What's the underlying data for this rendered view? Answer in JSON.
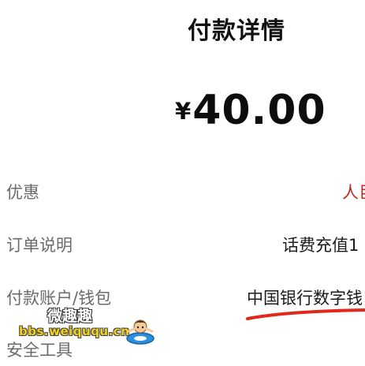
{
  "header": {
    "title": "付款详情"
  },
  "payment": {
    "currency_symbol": "¥",
    "amount": "40.00"
  },
  "details": {
    "discount": {
      "label": "优惠",
      "value": "人巨"
    },
    "order": {
      "label": "订单说明",
      "value": "话费充值1"
    },
    "account": {
      "label": "付款账户/钱包",
      "value": "中国银行数字钱"
    },
    "tool": {
      "label": "安全工具"
    }
  },
  "annotation": {
    "underline_color": "#e0281d"
  },
  "watermark": {
    "title": "微趣趣",
    "url": "bbs.weiququ.cn",
    "mascot_icon": "swimming-mascot-icon"
  },
  "colors": {
    "discount_value": "#c0281c",
    "label": "#6b6b6b"
  }
}
